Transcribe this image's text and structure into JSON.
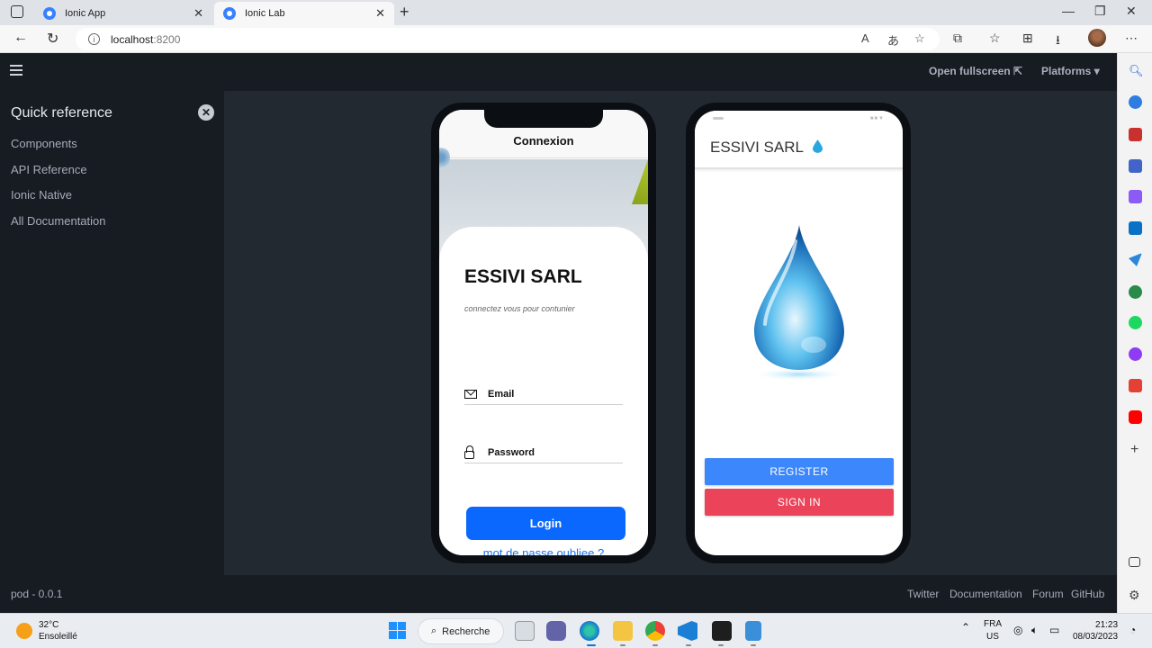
{
  "browser": {
    "tabs": [
      {
        "label": "Ionic App",
        "active": false
      },
      {
        "label": "Ionic Lab",
        "active": true
      }
    ],
    "url_host": "localhost",
    "url_port": ":8200"
  },
  "lab": {
    "open_fullscreen": "Open fullscreen",
    "platforms": "Platforms"
  },
  "sidebar": {
    "title": "Quick reference",
    "items": [
      {
        "label": "Components"
      },
      {
        "label": "API Reference"
      },
      {
        "label": "Ionic Native"
      },
      {
        "label": "All Documentation"
      }
    ]
  },
  "phone1": {
    "header_title": "Connexion",
    "brand": "ESSIVI SARL",
    "subtitle": "connectez vous pour contunier",
    "email_label": "Email",
    "password_label": "Password",
    "login_label": "Login",
    "forgot_label": "mot de passe oubliee ?"
  },
  "phone2": {
    "title": "ESSIVI SARL",
    "register_label": "REGISTER",
    "signin_label": "SIGN IN"
  },
  "footer": {
    "version": "pod - 0.0.1",
    "links": [
      "Twitter",
      "Documentation",
      "Forum",
      "GitHub"
    ]
  },
  "taskbar": {
    "temperature": "32°C",
    "weather": "Ensoleillé",
    "search_label": "Recherche",
    "lang_top": "FRA",
    "lang_bottom": "US",
    "time": "21:23",
    "date": "08/03/2023"
  },
  "colors": {
    "ionic_blue": "#3880ff",
    "login_blue": "#0a68ff",
    "register_blue": "#3c87fb",
    "signin_red": "#eb445a",
    "lab_dark": "#171b22"
  }
}
